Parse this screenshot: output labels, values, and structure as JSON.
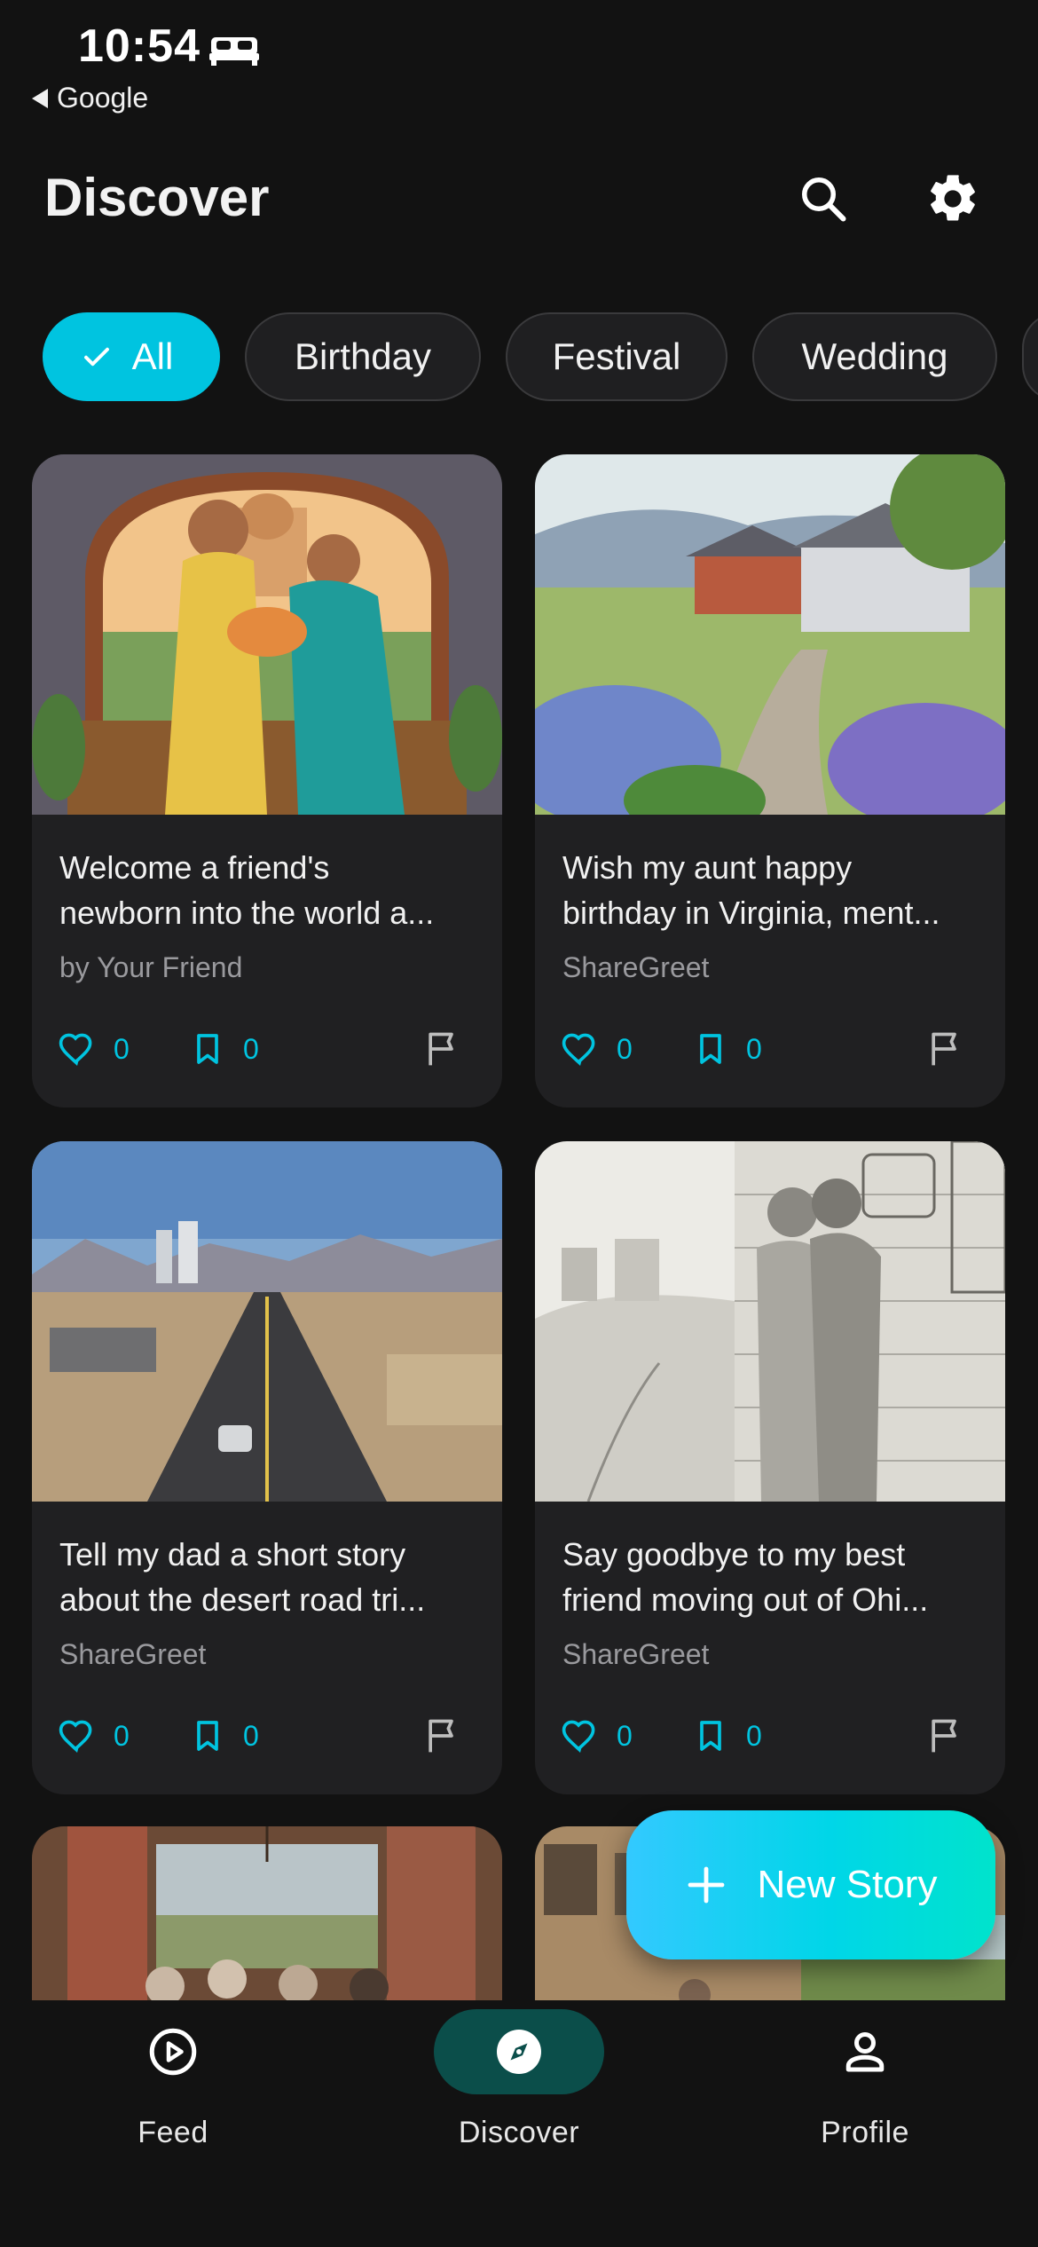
{
  "status_bar": {
    "time": "10:54",
    "back_app": "Google"
  },
  "header": {
    "title": "Discover"
  },
  "filters": {
    "chips": [
      {
        "label": "All",
        "selected": true
      },
      {
        "label": "Birthday",
        "selected": false
      },
      {
        "label": "Festival",
        "selected": false
      },
      {
        "label": "Wedding",
        "selected": false
      }
    ]
  },
  "cards": [
    {
      "title_line1": "Welcome a friend's",
      "title_line2": "newborn into the world a...",
      "author": "by Your Friend",
      "likes": "0",
      "saves": "0"
    },
    {
      "title_line1": "Wish my aunt happy",
      "title_line2": "birthday in Virginia, ment...",
      "author": "ShareGreet",
      "likes": "0",
      "saves": "0"
    },
    {
      "title_line1": "Tell my dad a short story",
      "title_line2": "about the desert road tri...",
      "author": "ShareGreet",
      "likes": "0",
      "saves": "0"
    },
    {
      "title_line1": "Say goodbye to my best",
      "title_line2": "friend moving out of Ohi...",
      "author": "ShareGreet",
      "likes": "0",
      "saves": "0"
    }
  ],
  "fab": {
    "label": "New Story"
  },
  "bottom_nav": {
    "items": [
      {
        "label": "Feed",
        "icon": "play-circle-icon",
        "active": false
      },
      {
        "label": "Discover",
        "icon": "compass-icon",
        "active": true
      },
      {
        "label": "Profile",
        "icon": "person-icon",
        "active": false
      }
    ]
  },
  "colors": {
    "accent": "#00c4e0",
    "background": "#121212",
    "card": "#202022",
    "nav_active": "#0b4e4a"
  }
}
